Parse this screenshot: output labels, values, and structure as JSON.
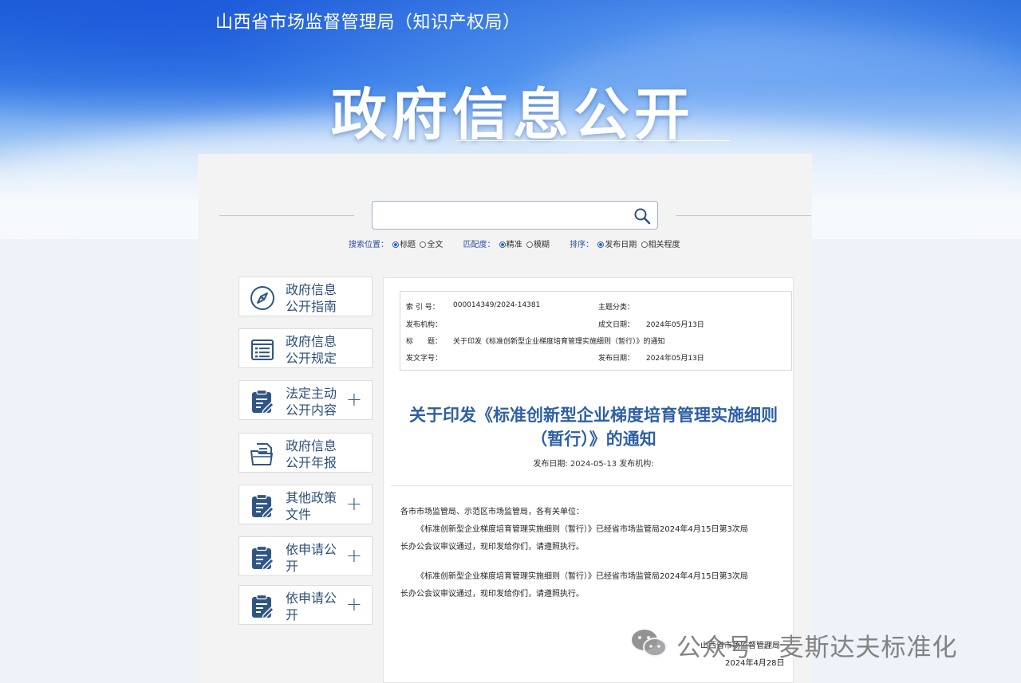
{
  "header": {
    "org_name": "山西省市场监督管理局（知识产权局）",
    "page_title": "政府信息公开"
  },
  "search": {
    "placeholder": "",
    "scope_label": "搜索位置：",
    "scope_options": [
      "标题",
      "全文"
    ],
    "scope_selected": "标题",
    "match_label": "匹配度：",
    "match_options": [
      "精准",
      "模糊"
    ],
    "match_selected": "精准",
    "sort_label": "排序：",
    "sort_options": [
      "发布日期",
      "相关程度"
    ],
    "sort_selected": "发布日期"
  },
  "sidebar": {
    "items": [
      {
        "label": "政府信息公开指南",
        "icon": "compass-icon",
        "expandable": false
      },
      {
        "label": "政府信息公开规定",
        "icon": "list-document-icon",
        "expandable": false
      },
      {
        "label": "法定主动公开内容",
        "icon": "clipboard-edit-icon",
        "expandable": true
      },
      {
        "label": "政府信息公开年报",
        "icon": "folder-document-icon",
        "expandable": false
      },
      {
        "label": "其他政策文件",
        "icon": "clipboard-edit-icon",
        "expandable": true
      },
      {
        "label": "依申请公开",
        "icon": "clipboard-edit-icon",
        "expandable": true
      },
      {
        "label": "依申请公开",
        "icon": "clipboard-edit-icon",
        "expandable": true
      }
    ]
  },
  "meta": {
    "index_label": "索 引 号：",
    "index_value": "000014349/2024-14381",
    "topic_label": "主题分类：",
    "topic_value": "",
    "publisher_label": "发布机构：",
    "publisher_value": "",
    "created_label": "成文日期：",
    "created_value": "2024年05月13日",
    "title_label": "标　　题：",
    "title_value": "关于印发《标准创新型企业梯度培育管理实施细则（暂行）》的通知",
    "docno_label": "发文字号：",
    "docno_value": "",
    "pubdate_label": "发布日期：",
    "pubdate_value": "2024年05月13日"
  },
  "document": {
    "title_line1": "关于印发《标准创新型企业梯度培育管理实施细则",
    "title_line2": "（暂行）》的通知",
    "subtitle": "发布日期: 2024-05-13 发布机构:",
    "salutation": "各市市场监管局、示范区市场监管局，各有关单位：",
    "para1_line1": "《标准创新型企业梯度培育管理实施细则（暂行）》已经省市场监管局2024年4月15日第3次局",
    "para1_line2": "长办公会议审议通过，现印发给你们，请遵照执行。",
    "para2_line1": "《标准创新型企业梯度培育管理实施细则（暂行）》已经省市场监管局2024年4月15日第3次局",
    "para2_line2": "长办公会议审议通过，现印发给你们，请遵照执行。",
    "footer_org": "山西省市场监督管理局",
    "footer_date": "2024年4月28日"
  },
  "watermark": {
    "text": "公众号 · 麦斯达夫标准化",
    "icon": "wechat-icon"
  },
  "colors": {
    "banner_blue": "#1c5fd6",
    "title_blue": "#2e5fa6",
    "nav_text": "#2d4f7a",
    "icon_blue": "#2f5683"
  }
}
